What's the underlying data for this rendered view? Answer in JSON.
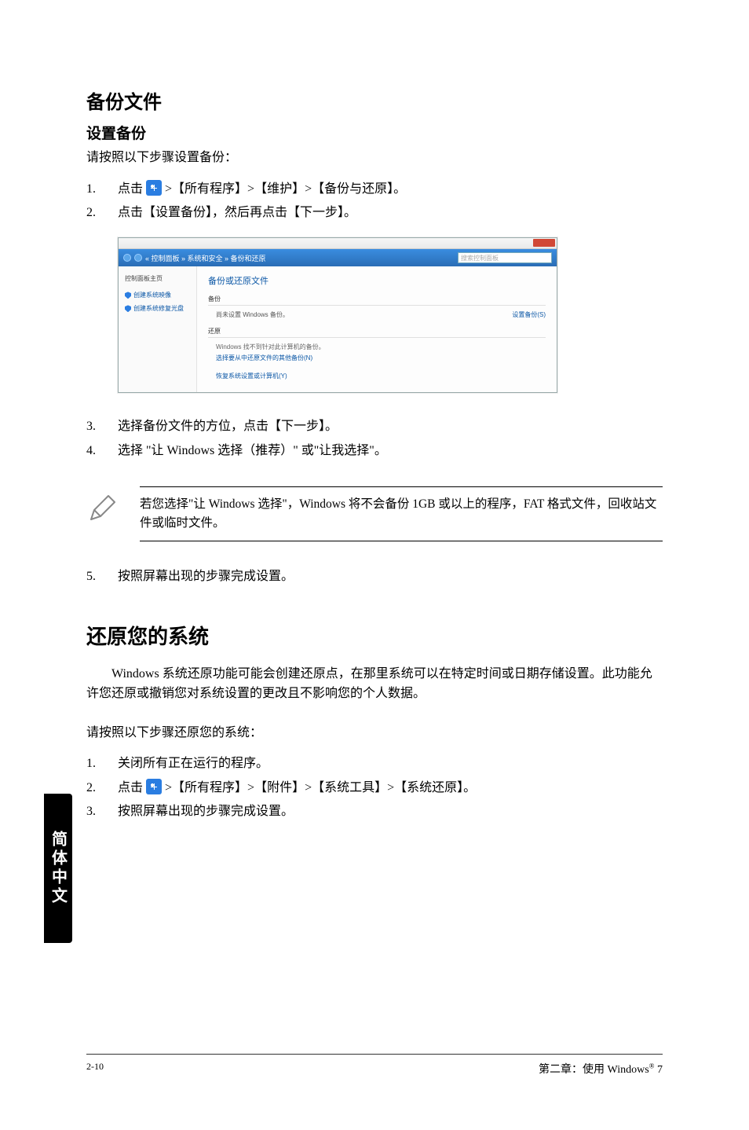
{
  "headings": {
    "backup_files": "备份文件",
    "setup_backup": "设置备份",
    "restore_system": "还原您的系统"
  },
  "intro": {
    "backup_steps_intro": "请按照以下步骤设置备份：",
    "restore_intro": "请按照以下步骤还原您的系统："
  },
  "backup_steps": {
    "s1_num": "1.",
    "s1_a": "点击 ",
    "s1_b": " >【所有程序】>【维护】>【备份与还原】。",
    "s2_num": "2.",
    "s2": "点击【设置备份】，然后再点击【下一步】。",
    "s3_num": "3.",
    "s3": "选择备份文件的方位，点击【下一步】。",
    "s4_num": "4.",
    "s4": "选择 \"让 Windows 选择（推荐）\" 或\"让我选择\"。",
    "s5_num": "5.",
    "s5": "按照屏幕出现的步骤完成设置。"
  },
  "note": {
    "text": "若您选择\"让 Windows 选择\"，Windows 将不会备份 1GB 或以上的程序，FAT 格式文件，回收站文件或临时文件。"
  },
  "restore_desc": "Windows 系统还原功能可能会创建还原点，在那里系统可以在特定时间或日期存储设置。此功能允许您还原或撤销您对系统设置的更改且不影响您的个人数据。",
  "restore_steps": {
    "s1_num": "1.",
    "s1": "关闭所有正在运行的程序。",
    "s2_num": "2.",
    "s2_a": "点击 ",
    "s2_b": " >【所有程序】>【附件】>【系统工具】>【系统还原】。",
    "s3_num": "3.",
    "s3": "按照屏幕出现的步骤完成设置。"
  },
  "screenshot": {
    "breadcrumb": "« 控制面板 » 系统和安全 » 备份和还原",
    "search_placeholder": "搜索控制面板",
    "sidebar_title": "控制面板主页",
    "sidebar_link1": "创建系统映像",
    "sidebar_link2": "创建系统修复光盘",
    "main_title": "备份或还原文件",
    "section1": "备份",
    "row1_text": "尚未设置 Windows 备份。",
    "row1_action": "设置备份(S)",
    "section2": "还原",
    "desc1": "Windows 找不到针对此计算机的备份。",
    "link2": "选择要从中还原文件的其他备份(N)",
    "link3": "恢复系统设置或计算机(Y)"
  },
  "side_tab": "简体中文",
  "footer": {
    "page": "2-10",
    "chapter_a": "第二章：使用 Windows",
    "chapter_b": " 7",
    "reg": "®"
  }
}
